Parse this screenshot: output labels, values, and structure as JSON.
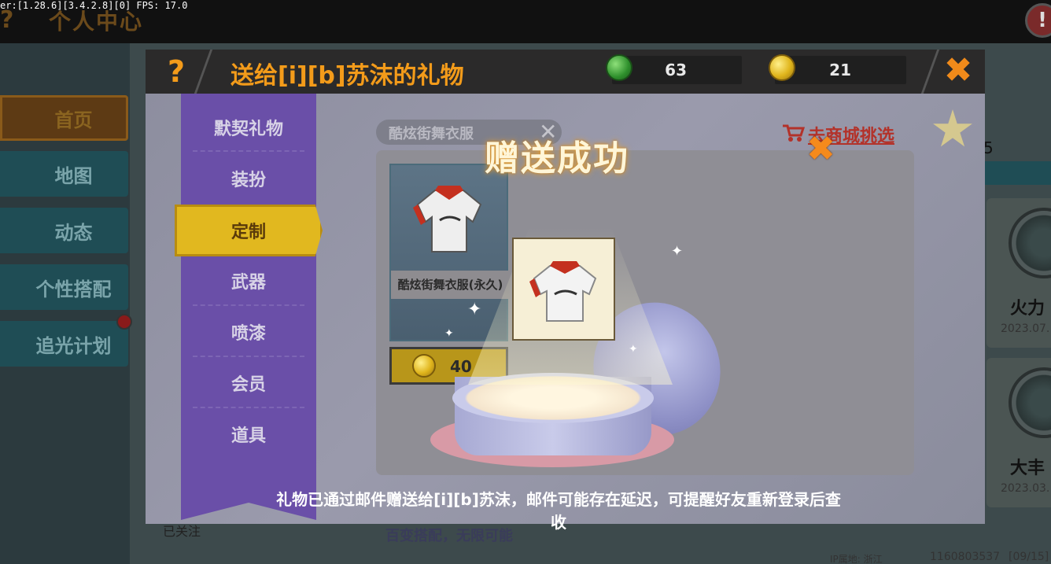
{
  "debug_overlay": "er:[1.28.6][3.4.2.8][0] FPS: 17.0",
  "background": {
    "page_title": "个人中心",
    "help_glyph": "?",
    "alert_glyph": "!",
    "nav_items": [
      {
        "label": "首页",
        "active": true
      },
      {
        "label": "地图",
        "active": false
      },
      {
        "label": "动态",
        "active": false
      },
      {
        "label": "个性搭配",
        "active": false
      },
      {
        "label": "追光计划",
        "active": false
      }
    ],
    "cards": [
      {
        "name": "火力",
        "date": "2023.07."
      },
      {
        "name": "大丰",
        "date": "2023.03."
      }
    ],
    "stat_fragment": "5",
    "followed_label": "已关注",
    "ip_location": "IP属地: 浙江",
    "user_id": "1160803537",
    "date_fragment": "[09/15]"
  },
  "dialog": {
    "help_glyph": "?",
    "title": "送给[i][b]苏沫的礼物",
    "currencies": [
      {
        "type": "gem",
        "value": "63"
      },
      {
        "type": "coin",
        "value": "21"
      }
    ],
    "close_glyph": "✖",
    "categories": [
      {
        "label": "默契礼物",
        "active": false
      },
      {
        "label": "装扮",
        "active": false
      },
      {
        "label": "定制",
        "active": true
      },
      {
        "label": "武器",
        "active": false
      },
      {
        "label": "喷漆",
        "active": false
      },
      {
        "label": "会员",
        "active": false
      },
      {
        "label": "道具",
        "active": false
      }
    ],
    "search_chip": "酷炫街舞衣服",
    "search_clear_glyph": "✕",
    "shop_link": "去商城挑选",
    "item": {
      "name": "酷炫街舞衣服(永久)",
      "price": "40"
    },
    "slogan": "百变搭配，无限可能"
  },
  "popup": {
    "title": "赠送成功",
    "close_glyph": "✖",
    "notice": "礼物已通过邮件赠送给[i][b]苏沫，邮件可能存在延迟，可提醒好友重新登录后查收"
  },
  "colors": {
    "accent_orange": "#f39b1a",
    "menu_purple": "#6a4fa8",
    "active_yellow": "#e1b81f",
    "link_red": "#b3322a"
  }
}
